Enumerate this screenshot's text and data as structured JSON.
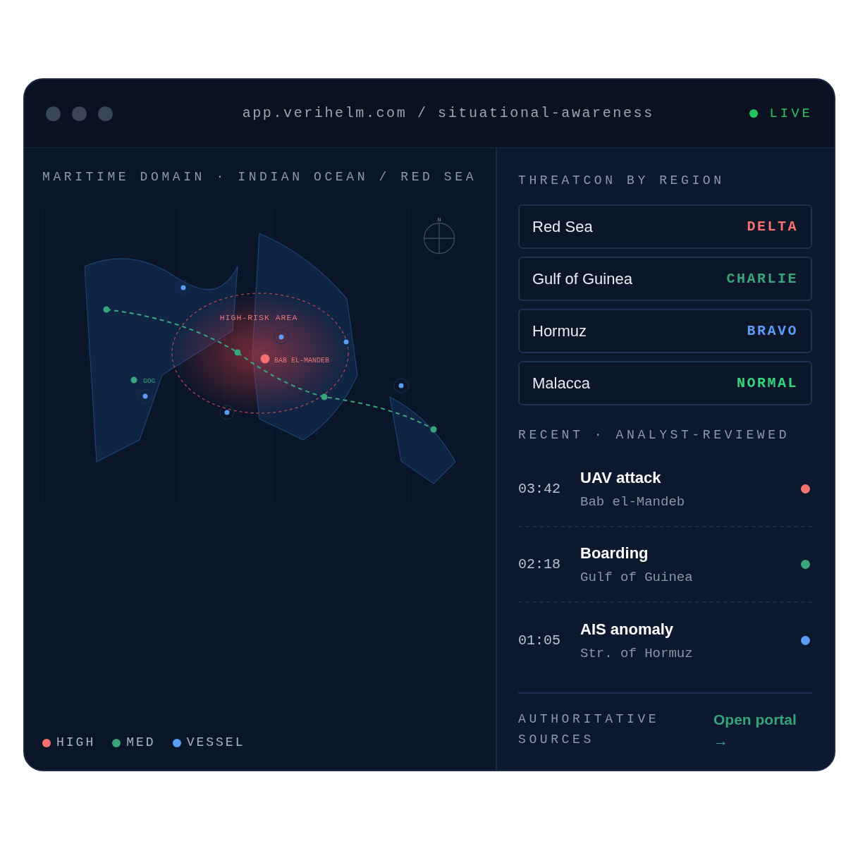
{
  "window": {
    "url": "app.verihelm.com / situational-awareness",
    "status": "LIVE"
  },
  "map": {
    "title": "MARITIME DOMAIN · INDIAN OCEAN / RED SEA",
    "compass": "N",
    "zone_label": "HIGH-RISK AREA",
    "incident_label": "BAB EL-MANDEB",
    "waypoint_label": "GOG",
    "legend": [
      {
        "label": "HIGH",
        "color": "#f87171"
      },
      {
        "label": "MED",
        "color": "#3aa57a"
      },
      {
        "label": "VESSEL",
        "color": "#5b9cf5"
      }
    ]
  },
  "threatcon": {
    "title": "THREATCON BY REGION",
    "regions": [
      {
        "name": "Red Sea",
        "level": "DELTA",
        "color": "#f87171"
      },
      {
        "name": "Gulf of Guinea",
        "level": "CHARLIE",
        "color": "#3aa57a"
      },
      {
        "name": "Hormuz",
        "level": "BRAVO",
        "color": "#5b9cf5"
      },
      {
        "name": "Malacca",
        "level": "NORMAL",
        "color": "#34d77f"
      }
    ]
  },
  "recent": {
    "title": "RECENT · ANALYST-REVIEWED",
    "events": [
      {
        "time": "03:42",
        "title": "UAV attack",
        "place": "Bab el-Mandeb",
        "color": "#f87171"
      },
      {
        "time": "02:18",
        "title": "Boarding",
        "place": "Gulf of Guinea",
        "color": "#3aa57a"
      },
      {
        "time": "01:05",
        "title": "AIS anomaly",
        "place": "Str. of Hormuz",
        "color": "#5b9cf5"
      }
    ]
  },
  "footer": {
    "label": "AUTHORITATIVE SOURCES",
    "link": "Open portal",
    "link_icon": "→"
  }
}
